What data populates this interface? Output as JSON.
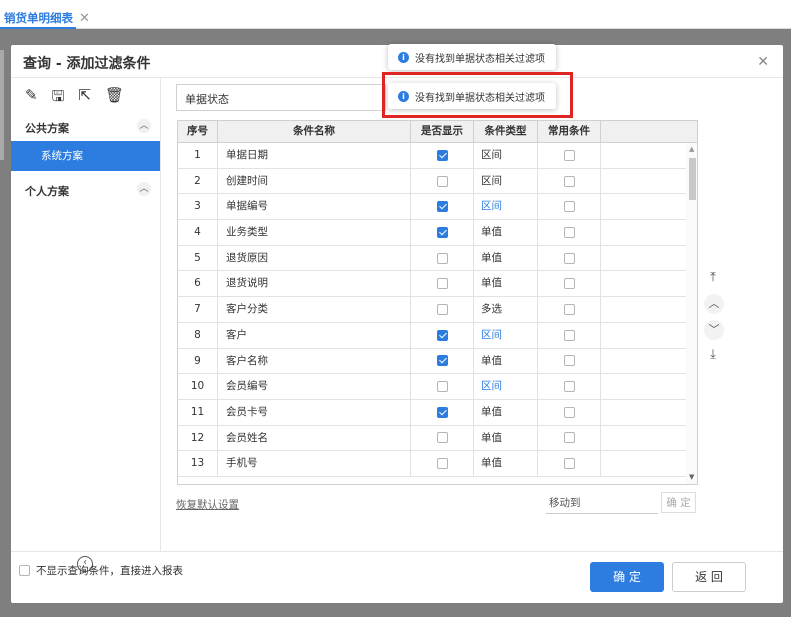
{
  "tab": {
    "label": "销货单明细表",
    "close": "✕"
  },
  "modal": {
    "title": "查询 - 添加过滤条件",
    "close": "✕"
  },
  "toolbar": {
    "icons": [
      "edit-icon",
      "save-icon",
      "export-icon",
      "delete-icon"
    ]
  },
  "sidebar": {
    "public_group": "公共方案",
    "scheme_item": "系统方案",
    "personal_group": "个人方案"
  },
  "filter_field": {
    "value": "单据状态"
  },
  "table": {
    "headers": [
      "序号",
      "条件名称",
      "是否显示",
      "条件类型",
      "常用条件"
    ],
    "rows": [
      {
        "no": "1",
        "name": "单据日期",
        "show": true,
        "type": "区间",
        "type_link": false,
        "common": false
      },
      {
        "no": "2",
        "name": "创建时间",
        "show": false,
        "type": "区间",
        "type_link": false,
        "common": false
      },
      {
        "no": "3",
        "name": "单据编号",
        "show": true,
        "type": "区间",
        "type_link": true,
        "common": false
      },
      {
        "no": "4",
        "name": "业务类型",
        "show": true,
        "type": "单值",
        "type_link": false,
        "common": false
      },
      {
        "no": "5",
        "name": "退货原因",
        "show": false,
        "type": "单值",
        "type_link": false,
        "common": false
      },
      {
        "no": "6",
        "name": "退货说明",
        "show": false,
        "type": "单值",
        "type_link": false,
        "common": false
      },
      {
        "no": "7",
        "name": "客户分类",
        "show": false,
        "type": "多选",
        "type_link": false,
        "common": false
      },
      {
        "no": "8",
        "name": "客户",
        "show": true,
        "type": "区间",
        "type_link": true,
        "common": false
      },
      {
        "no": "9",
        "name": "客户名称",
        "show": true,
        "type": "单值",
        "type_link": false,
        "common": false
      },
      {
        "no": "10",
        "name": "会员编号",
        "show": false,
        "type": "区间",
        "type_link": true,
        "common": false
      },
      {
        "no": "11",
        "name": "会员卡号",
        "show": true,
        "type": "单值",
        "type_link": false,
        "common": false
      },
      {
        "no": "12",
        "name": "会员姓名",
        "show": false,
        "type": "单值",
        "type_link": false,
        "common": false
      },
      {
        "no": "13",
        "name": "手机号",
        "show": false,
        "type": "单值",
        "type_link": false,
        "common": false
      }
    ]
  },
  "move_buttons": [
    "⤒",
    "︿",
    "﹀",
    "⤓"
  ],
  "bottom": {
    "restore": "恢复默认设置",
    "move_to": "移动到",
    "confirm_small": "确 定"
  },
  "footer": {
    "skip_label": "不显示查询条件，直接进入报表",
    "ok": "确 定",
    "back": "返 回"
  },
  "toasts": [
    {
      "text": "没有找到单据状态相关过滤项"
    },
    {
      "text": "没有找到单据状态相关过滤项"
    }
  ],
  "colors": {
    "accent": "#2d7de0",
    "highlight": "#e02424"
  }
}
